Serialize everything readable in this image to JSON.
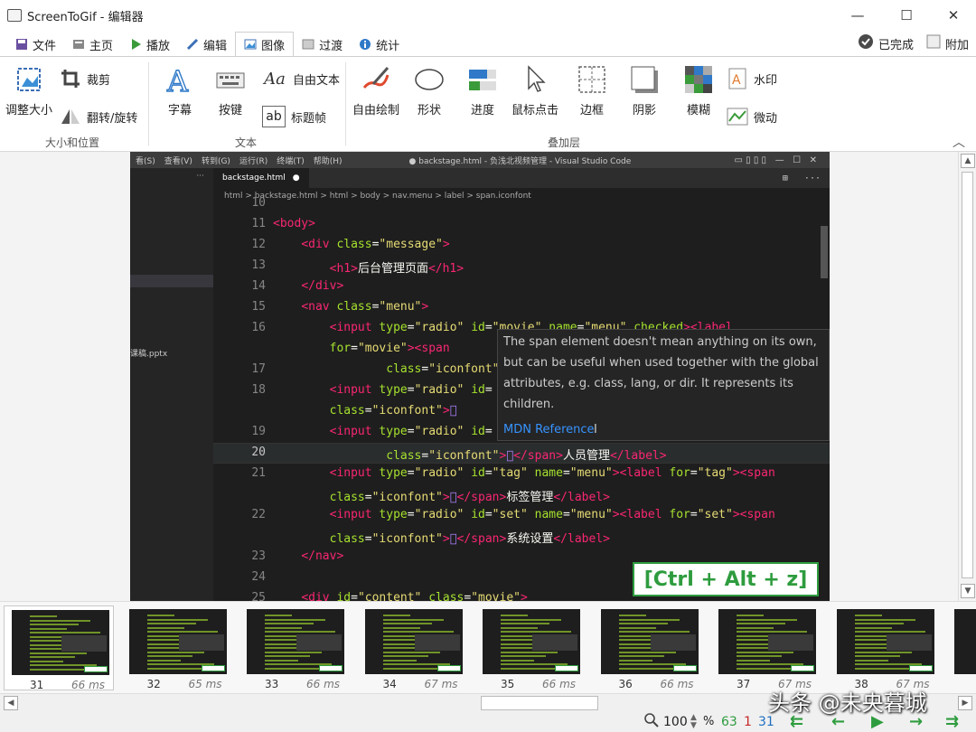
{
  "window": {
    "title": "ScreenToGif - 编辑器",
    "controls": [
      "—",
      "☐",
      "✕"
    ]
  },
  "tabs": [
    {
      "label": "文件",
      "icon": "save-icon"
    },
    {
      "label": "主页",
      "icon": "home-icon"
    },
    {
      "label": "播放",
      "icon": "play-icon"
    },
    {
      "label": "编辑",
      "icon": "pencil-icon"
    },
    {
      "label": "图像",
      "icon": "image-icon",
      "active": true
    },
    {
      "label": "过渡",
      "icon": "transition-icon"
    },
    {
      "label": "统计",
      "icon": "info-icon"
    }
  ],
  "tabs_right": {
    "done": "已完成",
    "attach": "附加"
  },
  "ribbon": {
    "resize": "调整大小",
    "crop": "裁剪",
    "flip": "翻转/旋转",
    "group_size": "大小和位置",
    "caption": "字幕",
    "keys": "按键",
    "freetext": "自由文本",
    "titleframe": "标题帧",
    "group_text": "文本",
    "freedraw": "自由绘制",
    "shape": "形状",
    "progress": "进度",
    "mouseclick": "鼠标点击",
    "border": "边框",
    "shadow": "阴影",
    "blur": "模糊",
    "watermark": "水印",
    "cinemagraph": "微动",
    "group_overlay": "叠加层"
  },
  "vscode": {
    "menu": [
      "看(S)",
      "查看(V)",
      "转到(G)",
      "运行(R)",
      "终端(T)",
      "帮助(H)"
    ],
    "window_title": "● backstage.html - 负浅北视频管理 - Visual Studio Code",
    "tab": "backstage.html",
    "crumbs": "html  >  backstage.html  >  html  >  body  >  nav.menu  >  label  >  span.iconfont",
    "sidebar_file": "课稿.pptx",
    "hover_text": "The span element doesn't mean anything on its own, but can be useful when used together with the global attributes, e.g. class, lang, or dir. It represents its children.",
    "hover_link": "MDN Reference",
    "shortcut": "[Ctrl + Alt + z]",
    "line_numbers": [
      "10",
      "11",
      "12",
      "13",
      "14",
      "15",
      "16",
      "",
      "17",
      "18",
      "",
      "19",
      "20",
      "21",
      "",
      "22",
      "",
      "23",
      "24",
      "25"
    ]
  },
  "frames": [
    {
      "num": "31",
      "ms": "66 ms"
    },
    {
      "num": "32",
      "ms": "65 ms"
    },
    {
      "num": "33",
      "ms": "66 ms"
    },
    {
      "num": "34",
      "ms": "67 ms"
    },
    {
      "num": "35",
      "ms": "66 ms"
    },
    {
      "num": "36",
      "ms": "66 ms"
    },
    {
      "num": "37",
      "ms": "67 ms"
    },
    {
      "num": "38",
      "ms": "67 ms"
    }
  ],
  "status": {
    "zoom": "100",
    "percent": "%",
    "total": "63",
    "selected": "1",
    "current": "31"
  },
  "watermark": "头条 @未央暮城",
  "colors": {
    "accent_green": "#2e9c3e",
    "editor_bg": "#1e1e1e"
  }
}
